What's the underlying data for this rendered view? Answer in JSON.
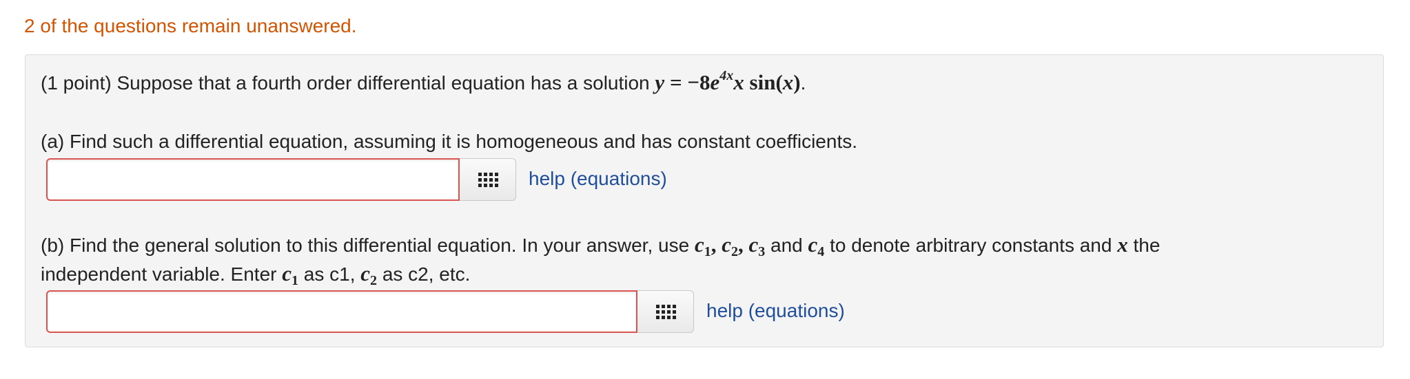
{
  "status_message": "2 of the questions remain unanswered.",
  "problem": {
    "intro_text": "(1 point) Suppose that a fourth order differential equation has a solution",
    "solution": {
      "y": "y",
      "eq": "=",
      "coeff": "−8",
      "base": "e",
      "exponent": "4x",
      "x": "x",
      "func": "sin",
      "arg_open": "(",
      "arg": "x",
      "arg_close": ")"
    },
    "intro_end": "."
  },
  "part_a": {
    "prompt": "(a) Find such a differential equation, assuming it is homogeneous and has constant coefficients.",
    "input_value": "",
    "keypad_icon": "grid-keypad-icon",
    "help_label": "help (equations)"
  },
  "part_b": {
    "prompt_1": "(b) Find the general solution to this differential equation. In your answer, use",
    "c": "c",
    "sub1": "1",
    "sub2": "2",
    "sub3": "3",
    "sub4": "4",
    "comma": ",",
    "and_1": "and",
    "prompt_2": "to denote arbitrary constants and",
    "x": "x",
    "prompt_3": "the",
    "line2_a": "independent variable. Enter",
    "line2_b": "as c1,",
    "line2_c": "as c2, etc.",
    "input_value": "",
    "keypad_icon": "grid-keypad-icon",
    "help_label": "help (equations)"
  },
  "colors": {
    "status": "#d35400",
    "input_border": "#d9534f",
    "link": "#1f4e9b",
    "panel_bg": "#f4f4f4"
  }
}
